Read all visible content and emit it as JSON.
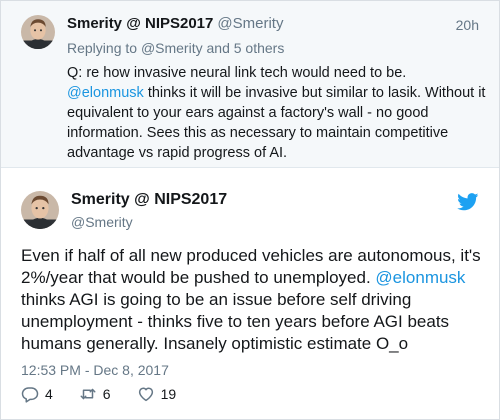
{
  "reply_tweet": {
    "author_name": "Smerity @ NIPS2017",
    "author_handle": "@Smerity",
    "time_ago": "20h",
    "replying_prefix": "Replying to",
    "replying_handle": "@Smerity",
    "replying_suffix": "and 5 others",
    "text_before_mention": "Q: re how invasive neural link tech would need to be.",
    "mention": "@elonmusk",
    "text_after_mention": "thinks it will be invasive but similar to lasik. Without it equivalent to your ears against a factory's wall - no good information. Sees this as necessary to maintain competitive advantage vs rapid progress of AI."
  },
  "main_tweet": {
    "author_name": "Smerity @ NIPS2017",
    "author_handle": "@Smerity",
    "text_before_mention": "Even if half of all new produced vehicles are autonomous, it's 2%/year that would be pushed to unemployed.",
    "mention": "@elonmusk",
    "text_after_mention": "thinks AGI is going to be an issue before self driving unemployment - thinks five to ten years before AGI beats humans generally. Insanely optimistic estimate O_o",
    "timestamp": "12:53 PM - Dec 8, 2017",
    "reply_count": "4",
    "retweet_count": "6",
    "like_count": "19"
  },
  "icons": {
    "reply": "reply-icon",
    "retweet": "retweet-icon",
    "like": "heart-icon",
    "brand": "twitter-bird-icon"
  },
  "colors": {
    "link_blue": "#1b95e0",
    "twitter_blue": "#1da1f2",
    "muted_gray": "#657786",
    "reply_background": "#f5f8fa"
  }
}
